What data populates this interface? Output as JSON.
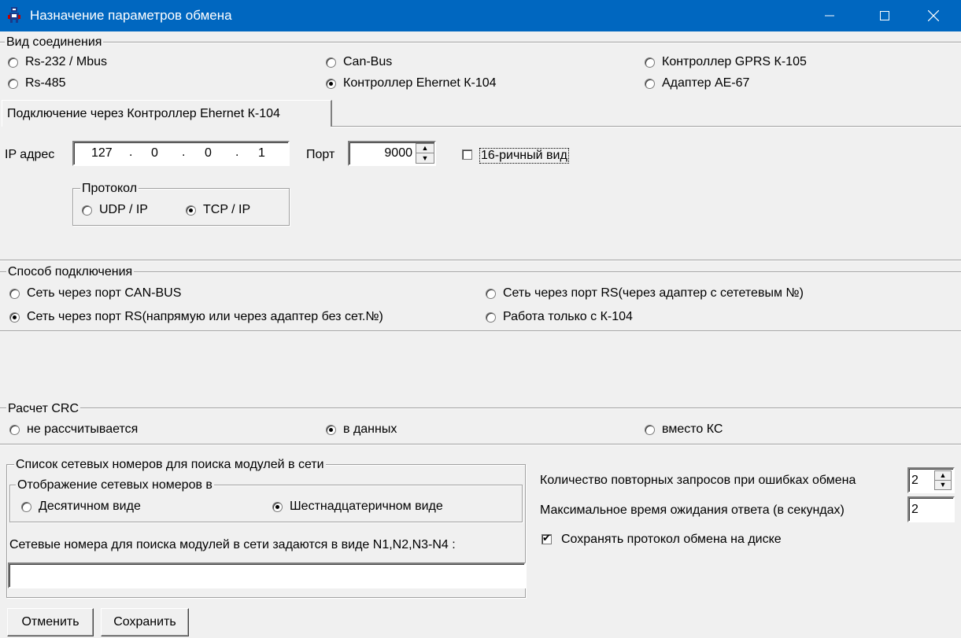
{
  "window": {
    "title": "Назначение параметров обмена",
    "minimize_icon": "minimize-icon",
    "maximize_icon": "maximize-icon",
    "close_icon": "close-icon",
    "title_bar_color": "#0067c0"
  },
  "connection_type": {
    "title": "Вид соединения",
    "options": [
      {
        "label": "Rs-232 / Mbus",
        "selected": false
      },
      {
        "label": "Can-Bus",
        "selected": false
      },
      {
        "label": "Контроллер GPRS К-105",
        "selected": false
      },
      {
        "label": "Rs-485",
        "selected": false
      },
      {
        "label": "Контроллер Ehernet К-104",
        "selected": true
      },
      {
        "label": "Адаптер АЕ-67",
        "selected": false
      }
    ]
  },
  "tab": {
    "label": "Подключение через Контроллер Ehernet К-104"
  },
  "ip": {
    "label": "IP адрес",
    "octets": [
      "127",
      "0",
      "0",
      "1"
    ],
    "separator": "."
  },
  "port": {
    "label": "Порт",
    "value": "9000"
  },
  "hex_view": {
    "label": "16-ричный вид",
    "checked": false
  },
  "protocol": {
    "title": "Протокол",
    "options": [
      {
        "label": "UDP / IP",
        "selected": false
      },
      {
        "label": "TCP / IP",
        "selected": true
      }
    ]
  },
  "connection_method": {
    "title": "Способ подключения",
    "options": [
      {
        "label": "Сеть через порт CAN-BUS",
        "selected": false
      },
      {
        "label": "Сеть через порт RS(через адаптер с сететевым №)",
        "selected": false
      },
      {
        "label": "Сеть через порт RS(напрямую или через адаптер без сет.№)",
        "selected": true
      },
      {
        "label": "Работа только с К-104",
        "selected": false
      }
    ]
  },
  "crc": {
    "title": "Расчет CRC",
    "options": [
      {
        "label": "не рассчитывается",
        "selected": false
      },
      {
        "label": "в данных",
        "selected": true
      },
      {
        "label": "вместо КС",
        "selected": false
      }
    ]
  },
  "network_list": {
    "title": "Список сетевых номеров для поиска модулей в сети",
    "display_title": "Отображение сетевых номеров в",
    "display_options": [
      {
        "label": "Десятичном виде",
        "selected": false
      },
      {
        "label": "Шестнадцатеричном виде",
        "selected": true
      }
    ],
    "hint": "Сетевые номера для поиска модулей в сети  задаются в виде N1,N2,N3-N4 :",
    "numbers_value": ""
  },
  "retries": {
    "label": "Количество повторных запросов при ошибках обмена",
    "value": "2"
  },
  "timeout": {
    "label": "Максимальное время ожидания ответа (в секундах)",
    "value": "2"
  },
  "save_log": {
    "label": "Сохранять протокол обмена на диске",
    "checked": true
  },
  "buttons": {
    "cancel": "Отменить",
    "save": "Сохранить"
  }
}
